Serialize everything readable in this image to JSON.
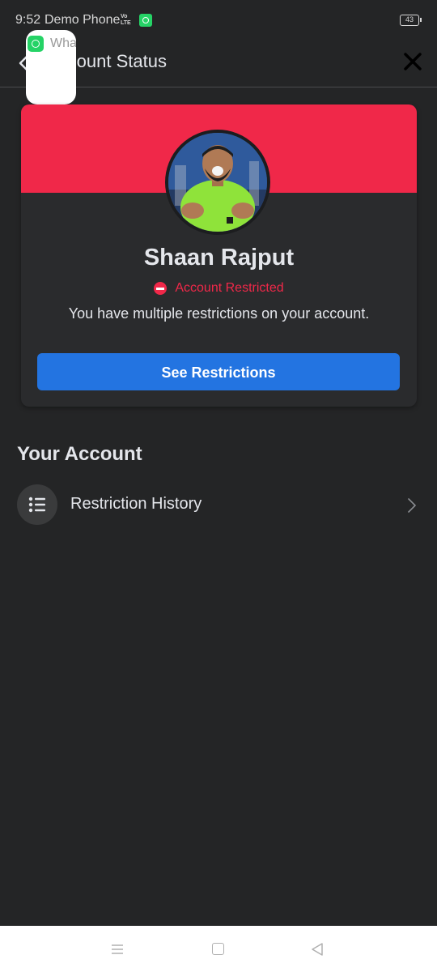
{
  "status_bar": {
    "time": "9:52",
    "carrier": "Demo Phone",
    "network_badge": "Vo LTE",
    "battery": "43"
  },
  "notification": {
    "app_icon": "whatsapp-business-icon",
    "text": "Wha"
  },
  "header": {
    "title": "Account Status",
    "back_icon": "back-arrow-icon",
    "close_icon": "close-icon"
  },
  "card": {
    "banner_color": "#f02849",
    "profile_name": "Shaan Rajput",
    "status_label": "Account Restricted",
    "status_icon": "restricted-icon",
    "message": "You have multiple restrictions on your account.",
    "button_label": "See Restrictions",
    "button_color": "#2374e1"
  },
  "your_account": {
    "title": "Your Account",
    "items": [
      {
        "label": "Restriction History",
        "icon": "list-icon"
      }
    ]
  },
  "nav_bar": {
    "menu_icon": "menu-icon",
    "home_icon": "home-icon",
    "back_icon": "back-triangle-icon"
  }
}
